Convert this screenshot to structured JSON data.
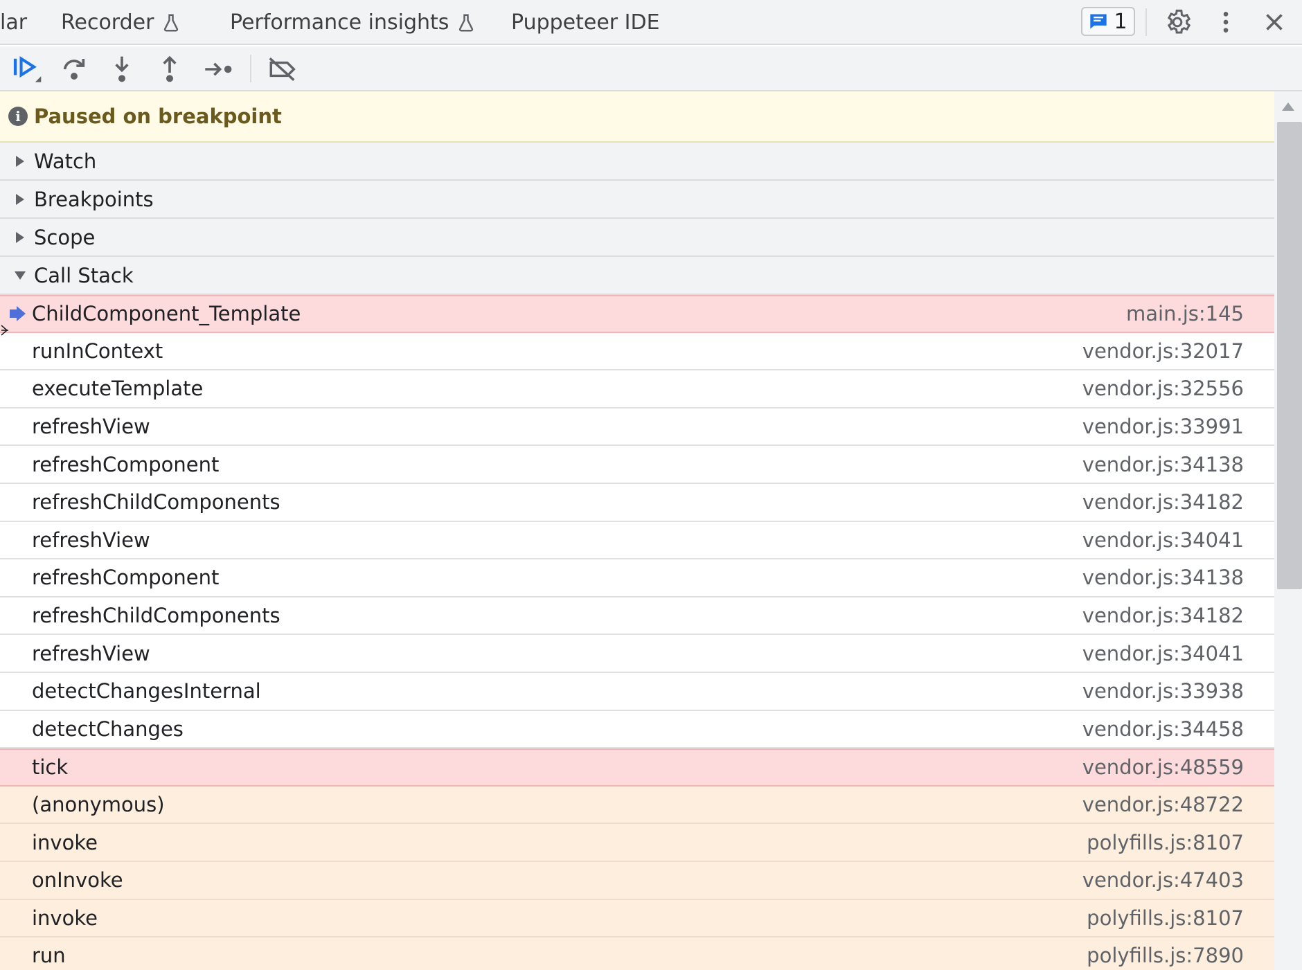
{
  "tabs": [
    {
      "label": "lar",
      "experimental": false
    },
    {
      "label": "Recorder",
      "experimental": true
    },
    {
      "label": "Performance insights",
      "experimental": true
    },
    {
      "label": "Puppeteer IDE",
      "experimental": false
    }
  ],
  "issues_badge": {
    "count": "1",
    "icon": "message-icon"
  },
  "top_icons": [
    "gear-icon",
    "more-vert-icon",
    "close-icon"
  ],
  "toolbar": {
    "buttons": [
      "resume-icon",
      "step-over-icon",
      "step-into-icon",
      "step-out-icon",
      "step-icon",
      "deactivate-breakpoints-icon"
    ]
  },
  "paused_message": "Paused on breakpoint",
  "sections": {
    "watch": "Watch",
    "breakpoints": "Breakpoints",
    "scope": "Scope",
    "call_stack": "Call Stack"
  },
  "call_stack": [
    {
      "fn": "ChildComponent_Template",
      "loc": "main.js:145"
    },
    {
      "fn": "runInContext",
      "loc": "vendor.js:32017"
    },
    {
      "fn": "executeTemplate",
      "loc": "vendor.js:32556"
    },
    {
      "fn": "refreshView",
      "loc": "vendor.js:33991"
    },
    {
      "fn": "refreshComponent",
      "loc": "vendor.js:34138"
    },
    {
      "fn": "refreshChildComponents",
      "loc": "vendor.js:34182"
    },
    {
      "fn": "refreshView",
      "loc": "vendor.js:34041"
    },
    {
      "fn": "refreshComponent",
      "loc": "vendor.js:34138"
    },
    {
      "fn": "refreshChildComponents",
      "loc": "vendor.js:34182"
    },
    {
      "fn": "refreshView",
      "loc": "vendor.js:34041"
    },
    {
      "fn": "detectChangesInternal",
      "loc": "vendor.js:33938"
    },
    {
      "fn": "detectChanges",
      "loc": "vendor.js:34458"
    },
    {
      "fn": "tick",
      "loc": "vendor.js:48559"
    },
    {
      "fn": "(anonymous)",
      "loc": "vendor.js:48722"
    },
    {
      "fn": "invoke",
      "loc": "polyfills.js:8107"
    },
    {
      "fn": "onInvoke",
      "loc": "vendor.js:47403"
    },
    {
      "fn": "invoke",
      "loc": "polyfills.js:8107"
    },
    {
      "fn": "run",
      "loc": "polyfills.js:7890"
    }
  ],
  "colors": {
    "accent": "#1a73e8",
    "current_frame_bg": "#fddadb",
    "async_frame_bg": "#fdeede",
    "paused_bg": "#fffbe6"
  }
}
